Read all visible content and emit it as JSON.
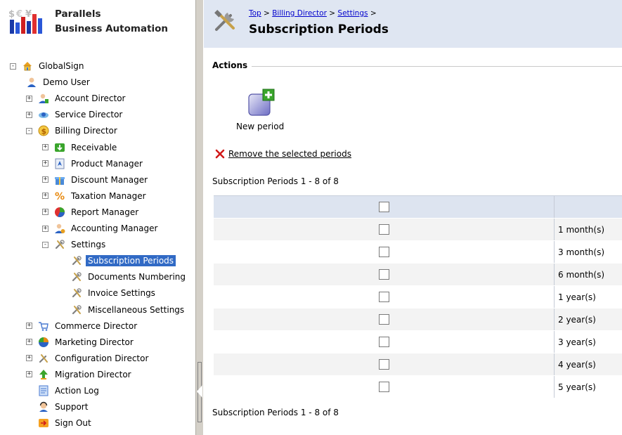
{
  "logo": {
    "line1": "Parallels",
    "line2": "Business Automation"
  },
  "tree": [
    {
      "label": "GlobalSign",
      "toggle": "-",
      "icon": "home-icon"
    },
    {
      "label": "Demo User",
      "toggle": "",
      "icon": "user-icon"
    },
    {
      "label": "Account Director",
      "toggle": "+",
      "icon": "account-director-icon"
    },
    {
      "label": "Service Director",
      "toggle": "+",
      "icon": "service-director-icon"
    },
    {
      "label": "Billing Director",
      "toggle": "-",
      "icon": "billing-director-icon"
    },
    {
      "label": "Receivable",
      "toggle": "+",
      "icon": "receivable-icon"
    },
    {
      "label": "Product Manager",
      "toggle": "+",
      "icon": "product-manager-icon"
    },
    {
      "label": "Discount Manager",
      "toggle": "+",
      "icon": "discount-manager-icon"
    },
    {
      "label": "Taxation Manager",
      "toggle": "+",
      "icon": "taxation-manager-icon"
    },
    {
      "label": "Report Manager",
      "toggle": "+",
      "icon": "report-manager-icon"
    },
    {
      "label": "Accounting Manager",
      "toggle": "+",
      "icon": "accounting-manager-icon"
    },
    {
      "label": "Settings",
      "toggle": "-",
      "icon": "settings-tools-icon"
    },
    {
      "label": "Subscription Periods",
      "toggle": "",
      "icon": "settings-tools-icon",
      "selected": true
    },
    {
      "label": "Documents Numbering",
      "toggle": "",
      "icon": "settings-tools-icon"
    },
    {
      "label": "Invoice Settings",
      "toggle": "",
      "icon": "settings-tools-icon"
    },
    {
      "label": "Miscellaneous Settings",
      "toggle": "",
      "icon": "settings-tools-icon"
    },
    {
      "label": "Commerce Director",
      "toggle": "+",
      "icon": "commerce-director-icon"
    },
    {
      "label": "Marketing Director",
      "toggle": "+",
      "icon": "marketing-director-icon"
    },
    {
      "label": "Configuration Director",
      "toggle": "+",
      "icon": "configuration-director-icon"
    },
    {
      "label": "Migration Director",
      "toggle": "+",
      "icon": "migration-director-icon"
    },
    {
      "label": "Action Log",
      "toggle": "",
      "icon": "action-log-icon"
    },
    {
      "label": "Support",
      "toggle": "",
      "icon": "support-icon"
    },
    {
      "label": "Sign Out",
      "toggle": "",
      "icon": "sign-out-icon"
    }
  ],
  "header": {
    "breadcrumb": {
      "top": "Top",
      "billing": "Billing Director",
      "settings": "Settings",
      "sep": " > "
    },
    "title": "Subscription Periods"
  },
  "actions": {
    "legend": "Actions",
    "new_period": "New period",
    "remove": "Remove the selected periods"
  },
  "list": {
    "count_top": "Subscription Periods 1 - 8 of 8",
    "count_bottom": "Subscription Periods 1 - 8 of 8",
    "rows": [
      "1 month(s)",
      "3 month(s)",
      "6 month(s)",
      "1 year(s)",
      "2 year(s)",
      "3 year(s)",
      "4 year(s)",
      "5 year(s)"
    ]
  },
  "colors": {
    "header_bg": "#dfe6f2",
    "selection": "#316ac5",
    "link": "#0000cc",
    "remove_x": "#d11a1a"
  }
}
